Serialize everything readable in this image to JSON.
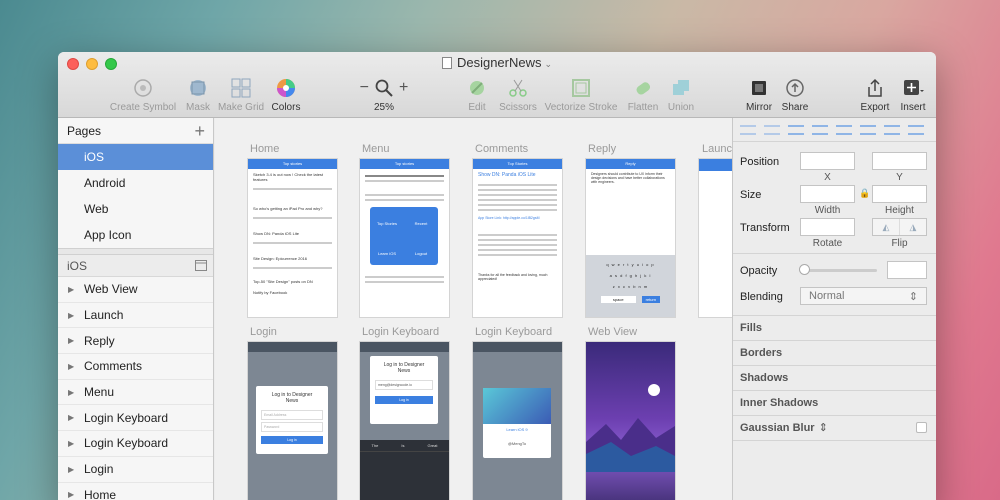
{
  "window": {
    "title": "DesignerNews"
  },
  "toolbar": {
    "create_symbol": "Create Symbol",
    "mask": "Mask",
    "make_grid": "Make Grid",
    "colors": "Colors",
    "zoom_out": "−",
    "zoom_in": "+",
    "zoom_level": "25%",
    "edit": "Edit",
    "scissors": "Scissors",
    "vectorize_stroke": "Vectorize Stroke",
    "flatten": "Flatten",
    "union": "Union",
    "mirror": "Mirror",
    "share": "Share",
    "export": "Export",
    "insert": "Insert"
  },
  "sidebar": {
    "pages_title": "Pages",
    "pages": [
      "iOS",
      "Android",
      "Web",
      "App Icon"
    ],
    "layers_title": "iOS",
    "layers": [
      "Web View",
      "Launch",
      "Reply",
      "Comments",
      "Menu",
      "Login Keyboard",
      "Login Keyboard",
      "Login",
      "Home"
    ]
  },
  "canvas": {
    "artboards": [
      "Home",
      "Menu",
      "Comments",
      "Reply",
      "Launc",
      "Login",
      "Login Keyboard",
      "Login Keyboard",
      "Web View"
    ],
    "home": {
      "bar": "Top stories",
      "items": [
        "Sketch 3.4 is out now ! Check the latest features",
        "So who's getting an iPad Pro and why?",
        "Show DN: Panda iOS Lite",
        "Site Design: Epicurrence 2016",
        "Top-50 \"Site Design\" posts on DN",
        "Notify by Facebook"
      ]
    },
    "menu": {
      "bar": "Top stories",
      "items": [
        "Top Stories",
        "Recent",
        "Learn iOS",
        "Logout"
      ]
    },
    "comments": {
      "bar": "Top Stories",
      "title": "Show DN: Panda iOS Lite",
      "link": "App Store Link: http://apple.co/1lB2gsM",
      "footer": "Thanks for all the feedback and loving, much appreciated!"
    },
    "reply": {
      "bar": "Reply",
      "send": "Send",
      "body": "Designers should contribute to UX inform their design decisions and have better collaborations with engineers.",
      "keys1": "q w e r t y u i o p",
      "keys2": "a s d f g h j k l",
      "keys3": "z x c v b n m",
      "space": "space",
      "return": "return"
    },
    "login": {
      "heading": "Log in to Designer News",
      "email": "Email Address",
      "password": "Password",
      "button": "Log in"
    },
    "login_keyboard": {
      "heading": "Log in to Designer News",
      "email": "meng@designcode.io",
      "button": "Log in",
      "suggest": [
        "The",
        "Is",
        "Great"
      ]
    },
    "login_keyboard2": {
      "learn": "Learn iOS 9",
      "twitter": "@MengTo"
    }
  },
  "inspector": {
    "position": "Position",
    "x": "X",
    "y": "Y",
    "size": "Size",
    "width": "Width",
    "height": "Height",
    "transform": "Transform",
    "rotate": "Rotate",
    "flip": "Flip",
    "opacity": "Opacity",
    "blending": "Blending",
    "blending_value": "Normal",
    "sections": [
      "Fills",
      "Borders",
      "Shadows",
      "Inner Shadows",
      "Gaussian Blur"
    ]
  },
  "colors": {
    "accent": "#5b8fd8",
    "ios_blue": "#3b7fe0"
  }
}
